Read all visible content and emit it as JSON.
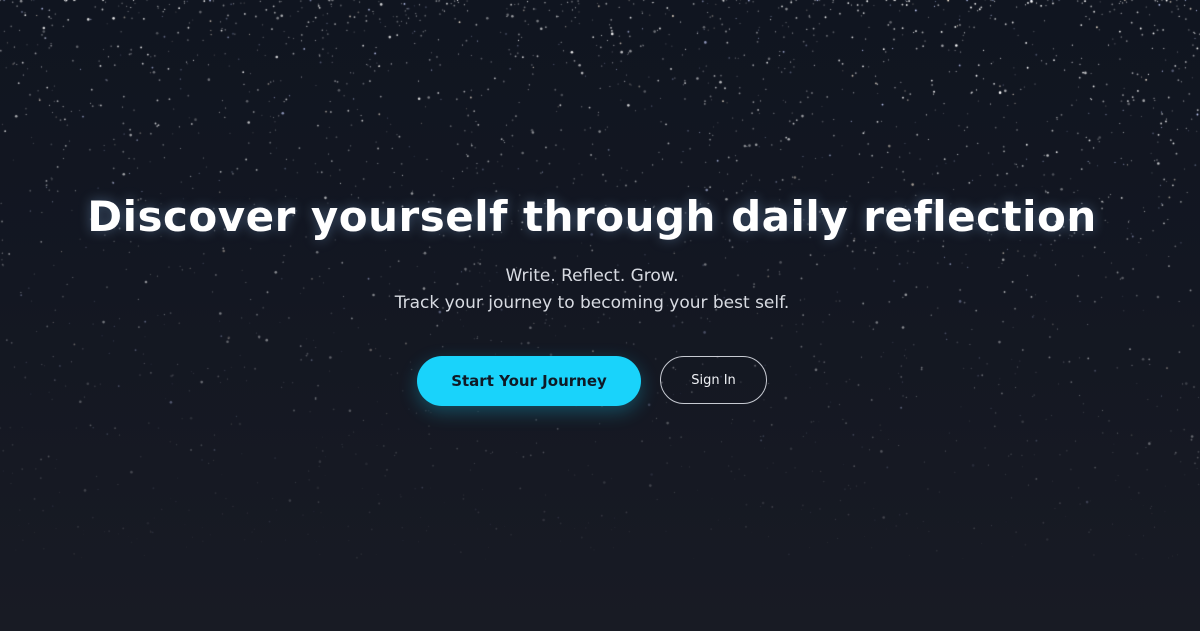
{
  "hero": {
    "title": "Discover yourself through daily reflection",
    "tagline": "Write. Reflect. Grow.",
    "subtitle": "Track your journey to becoming your best self."
  },
  "actions": {
    "primary_label": "Start Your Journey",
    "secondary_label": "Sign In"
  },
  "colors": {
    "accent": "#19d3fb",
    "background": "#131722"
  }
}
